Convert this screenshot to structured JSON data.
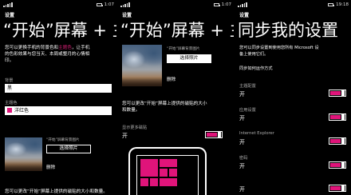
{
  "screen1": {
    "status_time": "1:07",
    "app_label": "设置",
    "title": "“开始”屏幕 + 主",
    "desc_before": "您可以更换手机的背景色和",
    "desc_accent": "主题色",
    "desc_after": "，让手机的色彩how随心所欲，本周或整月的心情相印。",
    "desc_line1": "您可以更换手机的背景色和",
    "desc_line1_accent": "主题色",
    "desc_line1_tail": "，让手机",
    "desc_line2": "的色彩效果与您当天、本周或整月的心情相",
    "desc_line3": "印。",
    "background_label": "背景",
    "background_value": "黑",
    "accent_label": "主题色",
    "accent_value": "洋红色",
    "accent_color": "#e0147a",
    "thumb_caption": "“开始”屏幕背景图片",
    "choose_photo": "选择照片",
    "delete": "删除",
    "bottom_text": "您可以更改“开始”屏幕上提供的磁贴的大小和数量。"
  },
  "screen2": {
    "status_time": "1:07",
    "app_label": "设置",
    "title": "“开始”屏幕 + 主",
    "thumb_caption": "“开始”屏幕背景图片",
    "choose_photo": "选择照片",
    "delete": "删除",
    "tiles_desc_line1": "您可以更改“开始”屏幕上提供的磁贴的大小",
    "tiles_desc_line2": "和数量。",
    "more_tiles_label": "显示更多磁贴",
    "more_tiles_value": "开"
  },
  "screen3": {
    "status_time": "19:18",
    "app_label": "设置",
    "title": "同步我的设置",
    "desc_line1": "您可以同步设置到使用您所有 Microsoft 设",
    "desc_line2": "备上使用它们。",
    "sync_how": "同步如何运作方式",
    "settings": [
      {
        "label": "主题配置",
        "value": "开"
      },
      {
        "label": "应用设置",
        "value": "开"
      },
      {
        "label": "Internet Explorer",
        "value": "开"
      },
      {
        "label": "密码",
        "value": "开"
      },
      {
        "label": "",
        "value": "开"
      }
    ]
  }
}
